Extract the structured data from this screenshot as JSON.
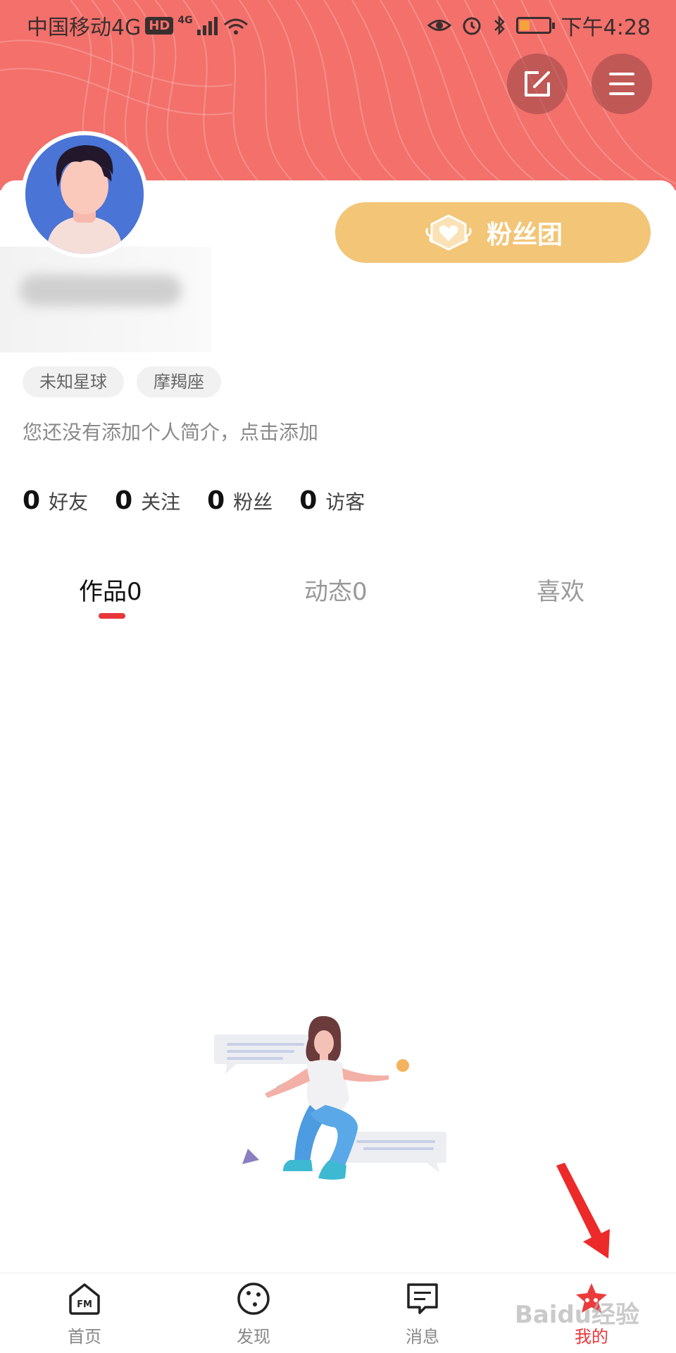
{
  "status_bar": {
    "carrier": "中国移动4G",
    "hd": "HD",
    "network": "4G",
    "time": "下午4:28"
  },
  "header": {
    "accent_color": "#f3706b",
    "edit_icon": "edit-icon",
    "menu_icon": "hamburger-menu-icon"
  },
  "profile": {
    "fans_group_label": "粉丝团",
    "tags": [
      "未知星球",
      "摩羯座"
    ],
    "bio_placeholder": "您还没有添加个人简介，点击添加",
    "stats": [
      {
        "value": "0",
        "label": "好友"
      },
      {
        "value": "0",
        "label": "关注"
      },
      {
        "value": "0",
        "label": "粉丝"
      },
      {
        "value": "0",
        "label": "访客"
      }
    ]
  },
  "tabs": [
    {
      "label": "作品0",
      "active": true
    },
    {
      "label": "动态0",
      "active": false
    },
    {
      "label": "喜欢",
      "active": false
    }
  ],
  "bottom_nav": [
    {
      "label": "首页",
      "icon": "fm-home-icon"
    },
    {
      "label": "发现",
      "icon": "discover-icon"
    },
    {
      "label": "消息",
      "icon": "message-icon"
    },
    {
      "label": "我的",
      "icon": "profile-icon",
      "active": true
    }
  ],
  "watermark": "Baidu经验"
}
